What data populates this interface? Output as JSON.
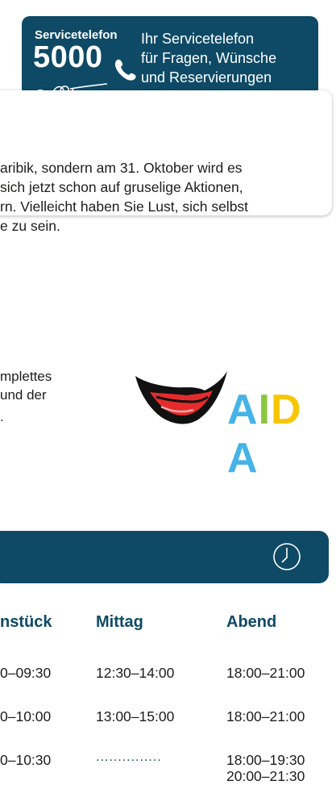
{
  "service": {
    "small_label": "Servicetelefon",
    "number": "5000",
    "lines": [
      "Ihr Servicetelefon",
      "für Fragen, Wünsche",
      "und Reservierungen"
    ]
  },
  "card": {
    "lines": [
      "aribik, sondern am 31. Oktober wird es",
      "sich jetzt schon auf gruselige Aktionen,",
      "rn. Vielleicht haben Sie Lust, sich selbst",
      "e zu sein."
    ]
  },
  "paragraph": {
    "lines": [
      "mplettes",
      "und der",
      "."
    ]
  },
  "logo": {
    "letters": [
      {
        "char": "A",
        "color": "#45b3e7"
      },
      {
        "char": "I",
        "color": "#8cc63f"
      },
      {
        "char": "D",
        "color": "#f7c600"
      },
      {
        "char": "A",
        "color": "#45b3e7"
      }
    ]
  },
  "schedule": {
    "headers": [
      "nstück",
      "Mittag",
      "Abend"
    ],
    "rows": [
      {
        "breakfast": "0–09:30",
        "lunch": "12:30–14:00",
        "dinner": [
          "18:00–21:00"
        ]
      },
      {
        "breakfast": "0–10:00",
        "lunch": "13:00–15:00",
        "dinner": [
          "18:00–21:00"
        ]
      },
      {
        "breakfast": "0–10:30",
        "lunch": "...............",
        "dinner": [
          "18:00–19:30",
          "20:00–21:30"
        ]
      }
    ]
  }
}
